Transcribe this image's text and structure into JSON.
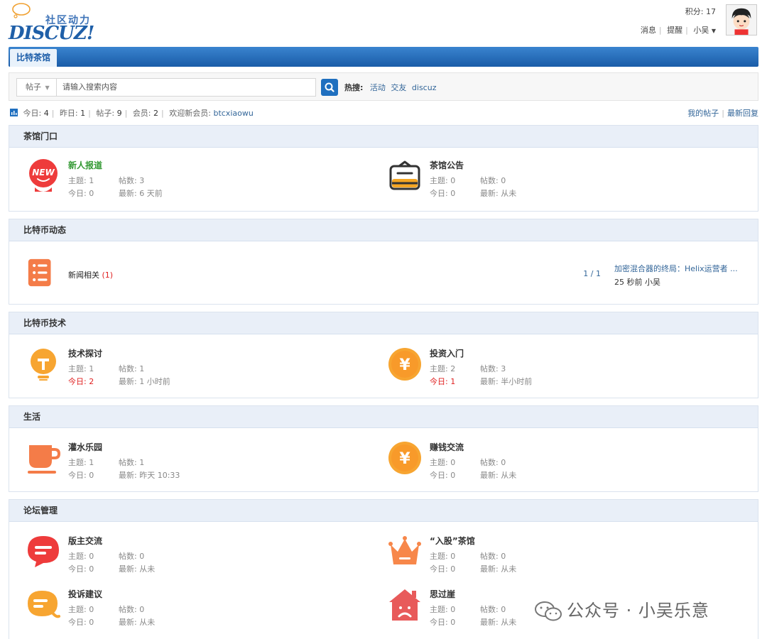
{
  "logo": {
    "cn": "社区动力",
    "en": "DISCUZ!"
  },
  "user": {
    "points": "积分: 17",
    "links": {
      "messages": "消息",
      "reminders": "提醒",
      "username": "小吴"
    }
  },
  "nav": {
    "active_tab": "比特茶馆"
  },
  "search": {
    "type": "帖子",
    "placeholder": "请输入搜索内容",
    "hot_label": "热搜:",
    "hot_terms": [
      "活动",
      "交友",
      "discuz"
    ]
  },
  "stats": {
    "today_label": "今日:",
    "today": "4",
    "yesterday_label": "昨日:",
    "yesterday": "1",
    "posts_label": "帖子:",
    "posts": "9",
    "members_label": "会员:",
    "members": "2",
    "welcome_label": "欢迎新会员:",
    "new_member": "btcxiaowu",
    "my_posts": "我的帖子",
    "latest_reply": "最新回复"
  },
  "sections": [
    {
      "title": "茶馆门口",
      "forums": [
        {
          "name": "新人报道",
          "topics": "主题: 1",
          "posts": "帖数: 3",
          "today": "今日: 0",
          "latest": "最新: 6 天前"
        },
        {
          "name": "茶馆公告",
          "topics": "主题: 0",
          "posts": "帖数: 0",
          "today": "今日: 0",
          "latest": "最新: 从未"
        }
      ]
    },
    {
      "title": "比特币动态",
      "forums": [
        {
          "name": "新闻相关",
          "count": "(1)",
          "pager": "1 / 1",
          "last_title": "加密混合器的终局：Helix运营者 ...",
          "last_meta": "25 秒前 小吴"
        }
      ]
    },
    {
      "title": "比特币技术",
      "forums": [
        {
          "name": "技术探讨",
          "topics": "主题: 1",
          "posts": "帖数: 1",
          "today": "今日: 2",
          "latest": "最新: 1 小时前"
        },
        {
          "name": "投资入门",
          "topics": "主题: 2",
          "posts": "帖数: 3",
          "today": "今日: 1",
          "latest": "最新: 半小时前"
        }
      ]
    },
    {
      "title": "生活",
      "forums": [
        {
          "name": "灌水乐园",
          "topics": "主题: 1",
          "posts": "帖数: 1",
          "today": "今日: 0",
          "latest": "最新: 昨天 10:33"
        },
        {
          "name": "赚钱交流",
          "topics": "主题: 0",
          "posts": "帖数: 0",
          "today": "今日: 0",
          "latest": "最新: 从未"
        }
      ]
    },
    {
      "title": "论坛管理",
      "forums": [
        {
          "name": "版主交流",
          "topics": "主题: 0",
          "posts": "帖数: 0",
          "today": "今日: 0",
          "latest": "最新: 从未"
        },
        {
          "name": "“入股”茶馆",
          "topics": "主题: 0",
          "posts": "帖数: 0",
          "today": "今日: 0",
          "latest": "最新: 从未"
        },
        {
          "name": "投诉建议",
          "topics": "主题: 0",
          "posts": "帖数: 0",
          "today": "今日: 0",
          "latest": "最新: 从未"
        },
        {
          "name": "思过崖",
          "topics": "主题: 0",
          "posts": "帖数: 0",
          "today": "今日: 0",
          "latest": "最新: 从未"
        }
      ]
    }
  ],
  "watermark": "公众号 · 小吴乐意",
  "icons": {
    "new-icon": "NEW",
    "yuan": "¥"
  },
  "colors": {
    "link": "#336699",
    "nav": "#1f5fa8",
    "today_red": "#e02020",
    "new_green": "#339933",
    "icon_orange": "#f5a623"
  }
}
